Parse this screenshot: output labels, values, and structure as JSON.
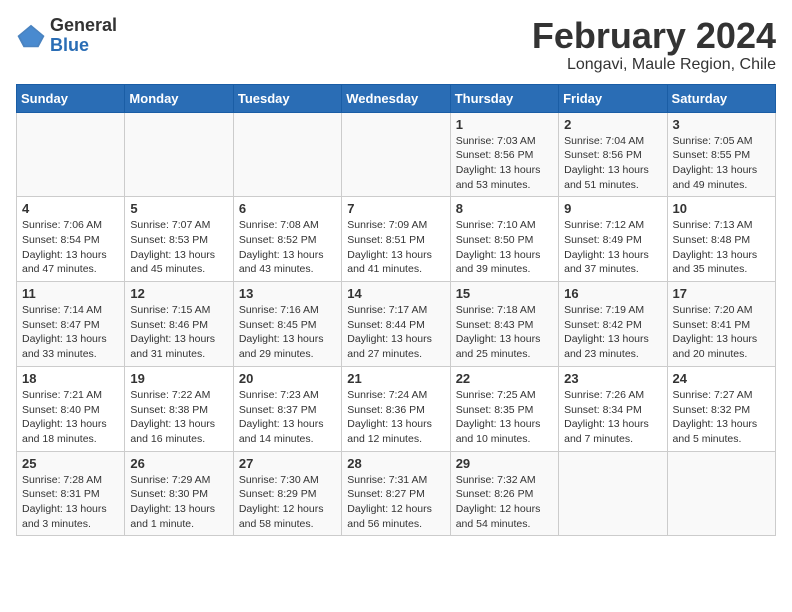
{
  "logo": {
    "general": "General",
    "blue": "Blue"
  },
  "title": "February 2024",
  "subtitle": "Longavi, Maule Region, Chile",
  "headers": [
    "Sunday",
    "Monday",
    "Tuesday",
    "Wednesday",
    "Thursday",
    "Friday",
    "Saturday"
  ],
  "weeks": [
    [
      {
        "day": "",
        "sunrise": "",
        "sunset": "",
        "daylight": ""
      },
      {
        "day": "",
        "sunrise": "",
        "sunset": "",
        "daylight": ""
      },
      {
        "day": "",
        "sunrise": "",
        "sunset": "",
        "daylight": ""
      },
      {
        "day": "",
        "sunrise": "",
        "sunset": "",
        "daylight": ""
      },
      {
        "day": "1",
        "sunrise": "Sunrise: 7:03 AM",
        "sunset": "Sunset: 8:56 PM",
        "daylight": "Daylight: 13 hours and 53 minutes."
      },
      {
        "day": "2",
        "sunrise": "Sunrise: 7:04 AM",
        "sunset": "Sunset: 8:56 PM",
        "daylight": "Daylight: 13 hours and 51 minutes."
      },
      {
        "day": "3",
        "sunrise": "Sunrise: 7:05 AM",
        "sunset": "Sunset: 8:55 PM",
        "daylight": "Daylight: 13 hours and 49 minutes."
      }
    ],
    [
      {
        "day": "4",
        "sunrise": "Sunrise: 7:06 AM",
        "sunset": "Sunset: 8:54 PM",
        "daylight": "Daylight: 13 hours and 47 minutes."
      },
      {
        "day": "5",
        "sunrise": "Sunrise: 7:07 AM",
        "sunset": "Sunset: 8:53 PM",
        "daylight": "Daylight: 13 hours and 45 minutes."
      },
      {
        "day": "6",
        "sunrise": "Sunrise: 7:08 AM",
        "sunset": "Sunset: 8:52 PM",
        "daylight": "Daylight: 13 hours and 43 minutes."
      },
      {
        "day": "7",
        "sunrise": "Sunrise: 7:09 AM",
        "sunset": "Sunset: 8:51 PM",
        "daylight": "Daylight: 13 hours and 41 minutes."
      },
      {
        "day": "8",
        "sunrise": "Sunrise: 7:10 AM",
        "sunset": "Sunset: 8:50 PM",
        "daylight": "Daylight: 13 hours and 39 minutes."
      },
      {
        "day": "9",
        "sunrise": "Sunrise: 7:12 AM",
        "sunset": "Sunset: 8:49 PM",
        "daylight": "Daylight: 13 hours and 37 minutes."
      },
      {
        "day": "10",
        "sunrise": "Sunrise: 7:13 AM",
        "sunset": "Sunset: 8:48 PM",
        "daylight": "Daylight: 13 hours and 35 minutes."
      }
    ],
    [
      {
        "day": "11",
        "sunrise": "Sunrise: 7:14 AM",
        "sunset": "Sunset: 8:47 PM",
        "daylight": "Daylight: 13 hours and 33 minutes."
      },
      {
        "day": "12",
        "sunrise": "Sunrise: 7:15 AM",
        "sunset": "Sunset: 8:46 PM",
        "daylight": "Daylight: 13 hours and 31 minutes."
      },
      {
        "day": "13",
        "sunrise": "Sunrise: 7:16 AM",
        "sunset": "Sunset: 8:45 PM",
        "daylight": "Daylight: 13 hours and 29 minutes."
      },
      {
        "day": "14",
        "sunrise": "Sunrise: 7:17 AM",
        "sunset": "Sunset: 8:44 PM",
        "daylight": "Daylight: 13 hours and 27 minutes."
      },
      {
        "day": "15",
        "sunrise": "Sunrise: 7:18 AM",
        "sunset": "Sunset: 8:43 PM",
        "daylight": "Daylight: 13 hours and 25 minutes."
      },
      {
        "day": "16",
        "sunrise": "Sunrise: 7:19 AM",
        "sunset": "Sunset: 8:42 PM",
        "daylight": "Daylight: 13 hours and 23 minutes."
      },
      {
        "day": "17",
        "sunrise": "Sunrise: 7:20 AM",
        "sunset": "Sunset: 8:41 PM",
        "daylight": "Daylight: 13 hours and 20 minutes."
      }
    ],
    [
      {
        "day": "18",
        "sunrise": "Sunrise: 7:21 AM",
        "sunset": "Sunset: 8:40 PM",
        "daylight": "Daylight: 13 hours and 18 minutes."
      },
      {
        "day": "19",
        "sunrise": "Sunrise: 7:22 AM",
        "sunset": "Sunset: 8:38 PM",
        "daylight": "Daylight: 13 hours and 16 minutes."
      },
      {
        "day": "20",
        "sunrise": "Sunrise: 7:23 AM",
        "sunset": "Sunset: 8:37 PM",
        "daylight": "Daylight: 13 hours and 14 minutes."
      },
      {
        "day": "21",
        "sunrise": "Sunrise: 7:24 AM",
        "sunset": "Sunset: 8:36 PM",
        "daylight": "Daylight: 13 hours and 12 minutes."
      },
      {
        "day": "22",
        "sunrise": "Sunrise: 7:25 AM",
        "sunset": "Sunset: 8:35 PM",
        "daylight": "Daylight: 13 hours and 10 minutes."
      },
      {
        "day": "23",
        "sunrise": "Sunrise: 7:26 AM",
        "sunset": "Sunset: 8:34 PM",
        "daylight": "Daylight: 13 hours and 7 minutes."
      },
      {
        "day": "24",
        "sunrise": "Sunrise: 7:27 AM",
        "sunset": "Sunset: 8:32 PM",
        "daylight": "Daylight: 13 hours and 5 minutes."
      }
    ],
    [
      {
        "day": "25",
        "sunrise": "Sunrise: 7:28 AM",
        "sunset": "Sunset: 8:31 PM",
        "daylight": "Daylight: 13 hours and 3 minutes."
      },
      {
        "day": "26",
        "sunrise": "Sunrise: 7:29 AM",
        "sunset": "Sunset: 8:30 PM",
        "daylight": "Daylight: 13 hours and 1 minute."
      },
      {
        "day": "27",
        "sunrise": "Sunrise: 7:30 AM",
        "sunset": "Sunset: 8:29 PM",
        "daylight": "Daylight: 12 hours and 58 minutes."
      },
      {
        "day": "28",
        "sunrise": "Sunrise: 7:31 AM",
        "sunset": "Sunset: 8:27 PM",
        "daylight": "Daylight: 12 hours and 56 minutes."
      },
      {
        "day": "29",
        "sunrise": "Sunrise: 7:32 AM",
        "sunset": "Sunset: 8:26 PM",
        "daylight": "Daylight: 12 hours and 54 minutes."
      },
      {
        "day": "",
        "sunrise": "",
        "sunset": "",
        "daylight": ""
      },
      {
        "day": "",
        "sunrise": "",
        "sunset": "",
        "daylight": ""
      }
    ]
  ]
}
